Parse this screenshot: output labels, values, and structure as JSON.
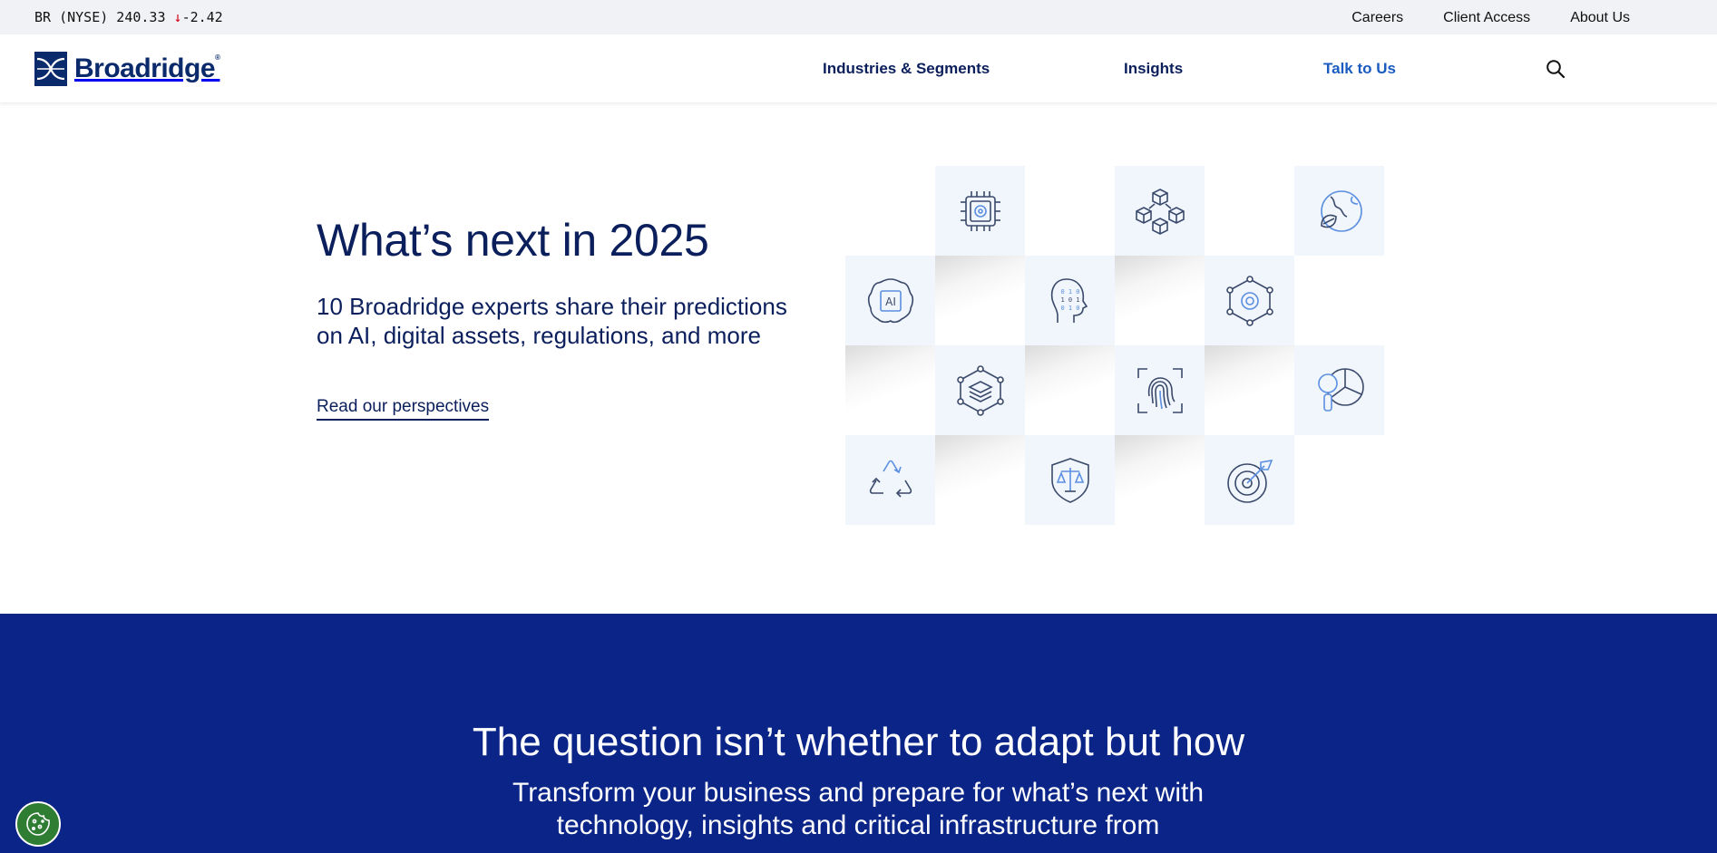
{
  "ticker": {
    "symbol": "BR (NYSE) 240.33",
    "arrow": "↓",
    "change": "-2.42",
    "down_color": "#d0021b"
  },
  "utility_links": [
    "Careers",
    "Client Access",
    "About Us"
  ],
  "brand": {
    "name": "Broadridge",
    "mark": "®",
    "color": "#0b2a6b"
  },
  "nav": {
    "items": [
      "Industries & Segments",
      "Insights",
      "Talk to Us"
    ],
    "accent_color": "#1a5bbf",
    "search_icon": "search-icon"
  },
  "hero": {
    "title": "What’s next in 2025",
    "subtitle": "10 Broadridge experts share their predictions on AI, digital assets, regulations, and more",
    "cta": "Read our perspectives",
    "tile_icons": [
      "chip-icon",
      "cubes-icon",
      "globe-leaf-icon",
      "ai-brain-icon",
      "data-head-icon",
      "network-gear-icon",
      "layers-hex-icon",
      "fingerprint-icon",
      "search-pie-icon",
      "recycle-icon",
      "justice-shield-icon",
      "target-icon"
    ]
  },
  "section": {
    "title": "The question isn’t whether to adapt but how",
    "subtitle": "Transform your business and prepare for what’s next with technology, insights and critical infrastructure from",
    "background": "#0a2487"
  },
  "cookie": {
    "icon": "cookie-icon",
    "color": "#2e7d32"
  }
}
